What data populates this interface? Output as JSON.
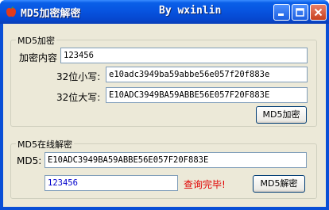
{
  "window": {
    "title": "MD5加密解密",
    "author": "By wxinlin"
  },
  "encrypt": {
    "group_label": "MD5加密",
    "content_label": "加密内容",
    "content_value": "123456",
    "lower_label": "32位小写:",
    "lower_value": "e10adc3949ba59abbe56e057f20f883e",
    "upper_label": "32位大写:",
    "upper_value": "E10ADC3949BA59ABBE56E057F20F883E",
    "button_label": "MD5加密"
  },
  "decrypt": {
    "group_label": "MD5在线解密",
    "md5_label": "MD5:",
    "md5_value": "E10ADC3949BA59ABBE56E057F20F883E",
    "result_value": "123456",
    "status_text": "查询完毕!",
    "button_label": "MD5解密"
  },
  "colors": {
    "titlebar": "#0754e0",
    "status": "#e00000",
    "result_text": "#0000cc"
  }
}
